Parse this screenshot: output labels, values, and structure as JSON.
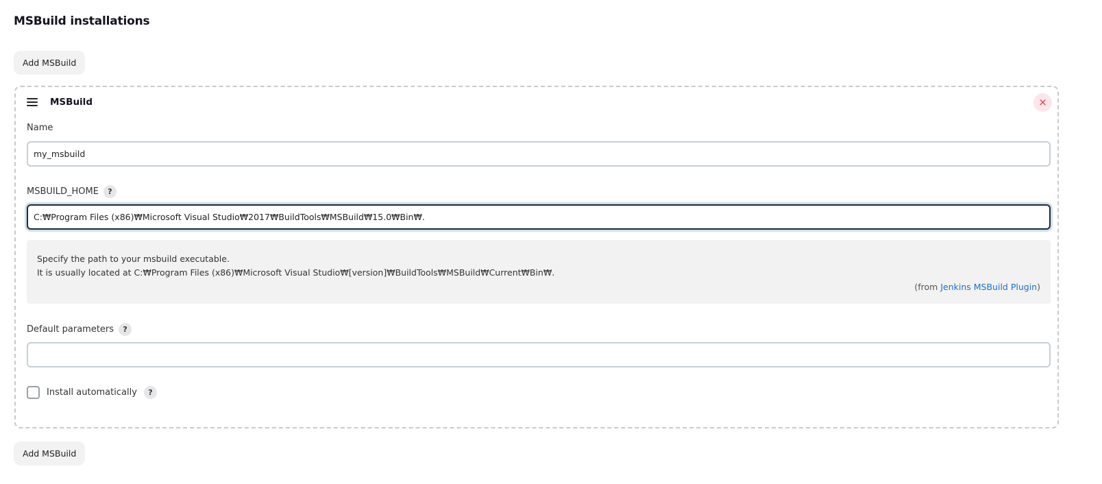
{
  "section": {
    "title": "MSBuild installations"
  },
  "buttons": {
    "add_top": "Add MSBuild",
    "add_bottom": "Add MSBuild"
  },
  "card": {
    "title": "MSBuild",
    "delete_glyph": "×",
    "fields": {
      "name": {
        "label": "Name",
        "value": "my_msbuild"
      },
      "msbuild_home": {
        "label": "MSBUILD_HOME",
        "value": "C:₩Program Files (x86)₩Microsoft Visual Studio₩2017₩BuildTools₩MSBuild₩15.0₩Bin₩."
      },
      "default_parameters": {
        "label": "Default parameters",
        "value": ""
      }
    },
    "help": {
      "line1": "Specify the path to your msbuild executable.",
      "line2": "It is usually located at C:₩Program Files (x86)₩Microsoft Visual Studio₩[version]₩BuildTools₩MSBuild₩Current₩Bin₩.",
      "from_prefix": "(from ",
      "from_link": "Jenkins MSBuild Plugin",
      "from_suffix": ")"
    },
    "install_automatically": {
      "label": "Install automatically",
      "checked": false
    },
    "help_icon_glyph": "?"
  },
  "colors": {
    "accent_link": "#1a6fcf",
    "delete_bg": "#fde6e8",
    "delete_fg": "#e0384a",
    "focus_ring": "#cfe0ec"
  },
  "icons": {
    "drag": "hamburger-icon",
    "delete": "close-icon",
    "help": "question-mark-icon"
  }
}
